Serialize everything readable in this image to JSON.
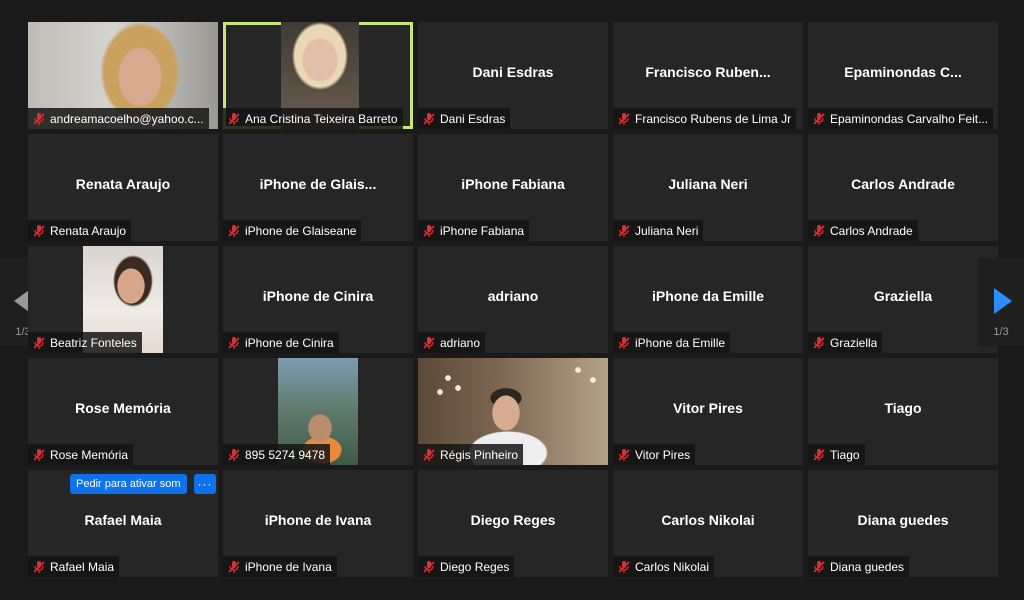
{
  "nav": {
    "prev_page": "1/3",
    "next_page": "1/3",
    "prev_arrow_color": "#9a9a9a",
    "next_arrow_color": "#2d8cff"
  },
  "colors": {
    "active_speaker_border": "#c8e67a",
    "muted_icon": "#e02d2d",
    "button_blue": "#0e72ed"
  },
  "unmute_request": {
    "label": "Pedir para ativar som",
    "more": "···"
  },
  "tiles": [
    {
      "label": "andreamacoelho@yahoo.c...",
      "center": "",
      "video": "v1"
    },
    {
      "label": "Ana Cristina Teixeira Barreto",
      "center": "",
      "video": "v2",
      "active": true
    },
    {
      "label": "Dani Esdras",
      "center": "Dani Esdras"
    },
    {
      "label": "Francisco Rubens de Lima Jr",
      "center": "Francisco  Ruben..."
    },
    {
      "label": "Epaminondas Carvalho Feit...",
      "center": "Epaminondas  C..."
    },
    {
      "label": "Renata Araujo",
      "center": "Renata Araujo"
    },
    {
      "label": "iPhone de Glaiseane",
      "center": "iPhone  de  Glais..."
    },
    {
      "label": "iPhone Fabiana",
      "center": "iPhone Fabiana"
    },
    {
      "label": "Juliana Neri",
      "center": "Juliana Neri"
    },
    {
      "label": "Carlos Andrade",
      "center": "Carlos Andrade"
    },
    {
      "label": "Beatriz Fonteles",
      "center": "",
      "video": "v3"
    },
    {
      "label": "iPhone de Cinira",
      "center": "iPhone de Cinira"
    },
    {
      "label": "adriano",
      "center": "adriano"
    },
    {
      "label": "iPhone da Emille",
      "center": "iPhone da Emille"
    },
    {
      "label": "Graziella",
      "center": "Graziella"
    },
    {
      "label": "Rose Memória",
      "center": "Rose Memória"
    },
    {
      "label": "895 5274 9478",
      "center": "",
      "video": "v4"
    },
    {
      "label": "Régis Pinheiro",
      "center": "",
      "video": "v5"
    },
    {
      "label": "Vitor Pires",
      "center": "Vitor Pires"
    },
    {
      "label": "Tiago",
      "center": "Tiago"
    },
    {
      "label": "Rafael Maia",
      "center": "Rafael Maia",
      "unmute_request": true
    },
    {
      "label": "iPhone de Ivana",
      "center": "iPhone de Ivana"
    },
    {
      "label": "Diego Reges",
      "center": "Diego Reges"
    },
    {
      "label": "Carlos Nikolai",
      "center": "Carlos Nikolai"
    },
    {
      "label": "Diana guedes",
      "center": "Diana guedes"
    }
  ]
}
